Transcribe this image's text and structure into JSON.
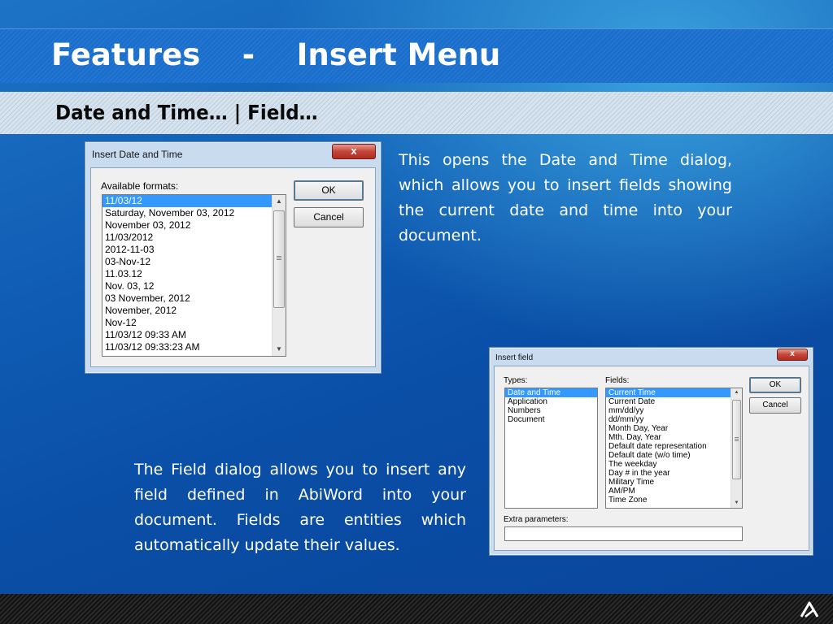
{
  "slide": {
    "title": "Features    -    Insert Menu",
    "subtitle": "Date and Time… | Field…",
    "paragraph1": "This opens the Date and Time dialog, which allows you to insert fields showing the current date and time into your document.",
    "paragraph2": "The Field dialog allows you to insert any field defined in AbiWord into your document. Fields are entities which automatically update their values."
  },
  "date_dialog": {
    "title": "Insert Date and Time",
    "close_label": "x",
    "formats_label": "Available formats:",
    "formats": [
      "11/03/12",
      "Saturday, November 03, 2012",
      "November 03, 2012",
      "11/03/2012",
      "2012-11-03",
      "03-Nov-12",
      "11.03.12",
      "Nov. 03, 12",
      "03 November, 2012",
      "November, 2012",
      "Nov-12",
      "11/03/12 09:33 AM",
      "11/03/12 09:33:23 AM"
    ],
    "selected_format": "11/03/12",
    "ok_label": "OK",
    "cancel_label": "Cancel"
  },
  "field_dialog": {
    "title": "Insert field",
    "close_label": "x",
    "types_label": "Types:",
    "types": [
      "Date and Time",
      "Application",
      "Numbers",
      "Document"
    ],
    "selected_type": "Date and Time",
    "fields_label": "Fields:",
    "fields": [
      "Current Time",
      "Current Date",
      "mm/dd/yy",
      "dd/mm/yy",
      "Month Day, Year",
      "Mth. Day, Year",
      "Default date representation",
      "Default date (w/o time)",
      "The weekday",
      "Day # in the year",
      "Military Time",
      "AM/PM",
      "Time Zone"
    ],
    "selected_field": "Current Time",
    "extra_params_label": "Extra parameters:",
    "extra_params_value": "",
    "ok_label": "OK",
    "cancel_label": "Cancel"
  },
  "colors": {
    "background": "#0f5bb3",
    "selection": "#3399ff",
    "dialog_frame": "#c9dcef",
    "close_button": "#c4453a"
  },
  "icons": {
    "logo": "abiword-a-logo-icon",
    "scroll_up": "scroll-up-arrow-icon",
    "scroll_down": "scroll-down-arrow-icon"
  }
}
